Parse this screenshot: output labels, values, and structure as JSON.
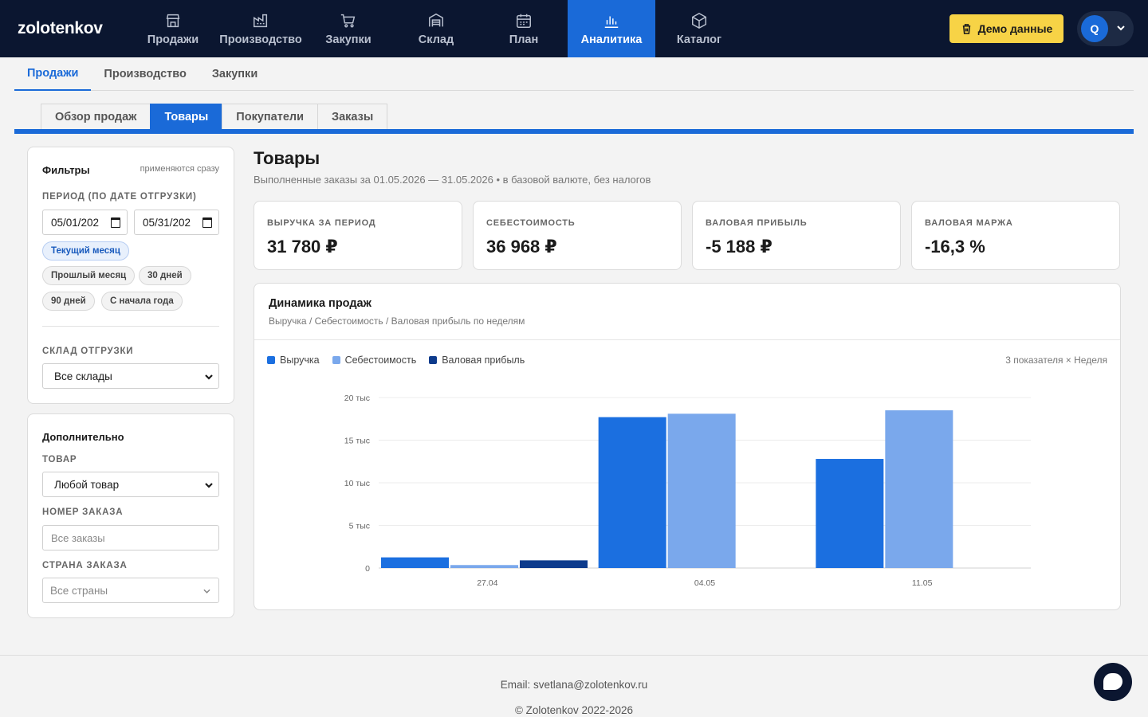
{
  "app": {
    "logo": "zolotenkov"
  },
  "nav": {
    "items": [
      {
        "label": "Продажи",
        "icon": "store-icon"
      },
      {
        "label": "Производство",
        "icon": "factory-icon"
      },
      {
        "label": "Закупки",
        "icon": "cart-icon"
      },
      {
        "label": "Склад",
        "icon": "warehouse-icon"
      },
      {
        "label": "План",
        "icon": "calendar-icon"
      },
      {
        "label": "Аналитика",
        "icon": "bar-chart-icon",
        "active": true
      },
      {
        "label": "Каталог",
        "icon": "box-icon"
      }
    ],
    "demo_label": "Демо данные",
    "user_initial": "Q"
  },
  "section_tabs": [
    "Продажи",
    "Производство",
    "Закупки"
  ],
  "sub_tabs": [
    "Обзор продаж",
    "Товары",
    "Покупатели",
    "Заказы"
  ],
  "filters": {
    "title": "Фильтры",
    "hint": "применяются сразу",
    "period_label": "ПЕРИОД (ПО ДАТЕ ОТГРУЗКИ)",
    "date_from": "05/01/202",
    "date_to": "05/31/202",
    "chips": [
      "Текущий месяц",
      "Прошлый месяц",
      "30 дней",
      "90 дней",
      "С начала года"
    ],
    "warehouse_label": "СКЛАД ОТГРУЗКИ",
    "warehouse_value": "Все склады"
  },
  "extra": {
    "title": "Дополнительно",
    "product_label": "ТОВАР",
    "product_value": "Любой товар",
    "order_label": "НОМЕР ЗАКАЗА",
    "order_placeholder": "Все заказы",
    "country_label": "СТРАНА ЗАКАЗА",
    "country_placeholder": "Все страны"
  },
  "main": {
    "title": "Товары",
    "subtitle": "Выполненные заказы за 01.05.2026 — 31.05.2026 • в базовой валюте, без налогов",
    "kpis": [
      {
        "label": "ВЫРУЧКА ЗА ПЕРИОД",
        "value": "31 780 ₽"
      },
      {
        "label": "СЕБЕСТОИМОСТЬ",
        "value": "36 968 ₽"
      },
      {
        "label": "ВАЛОВАЯ ПРИБЫЛЬ",
        "value": "-5 188 ₽"
      },
      {
        "label": "ВАЛОВАЯ МАРЖА",
        "value": "-16,3 %"
      }
    ],
    "chart_title": "Динамика продаж",
    "chart_subtitle": "Выручка / Себестоимость / Валовая прибыль по неделям",
    "chart_meta": "3 показателя × Неделя"
  },
  "chart_data": {
    "type": "bar",
    "categories": [
      "27.04",
      "04.05",
      "11.05"
    ],
    "series": [
      {
        "name": "Выручка",
        "color": "#1b6fe0",
        "values": [
          1250,
          17700,
          12800
        ]
      },
      {
        "name": "Себестоимость",
        "color": "#7aa8ec",
        "values": [
          350,
          18100,
          18500
        ]
      },
      {
        "name": "Валовая прибыль",
        "color": "#0d3b8c",
        "values": [
          900,
          null,
          null
        ]
      }
    ],
    "ylim": [
      0,
      20000
    ],
    "yticks": [
      0,
      5000,
      10000,
      15000,
      20000
    ],
    "ytick_labels": [
      "0",
      "5 тыс",
      "10 тыс",
      "15 тыс",
      "20 тыс"
    ],
    "grid": true,
    "legend": "top-left"
  },
  "footer": {
    "email": "Email: svetlana@zolotenkov.ru",
    "copyright": "© Zolotenkov 2022-2026"
  }
}
